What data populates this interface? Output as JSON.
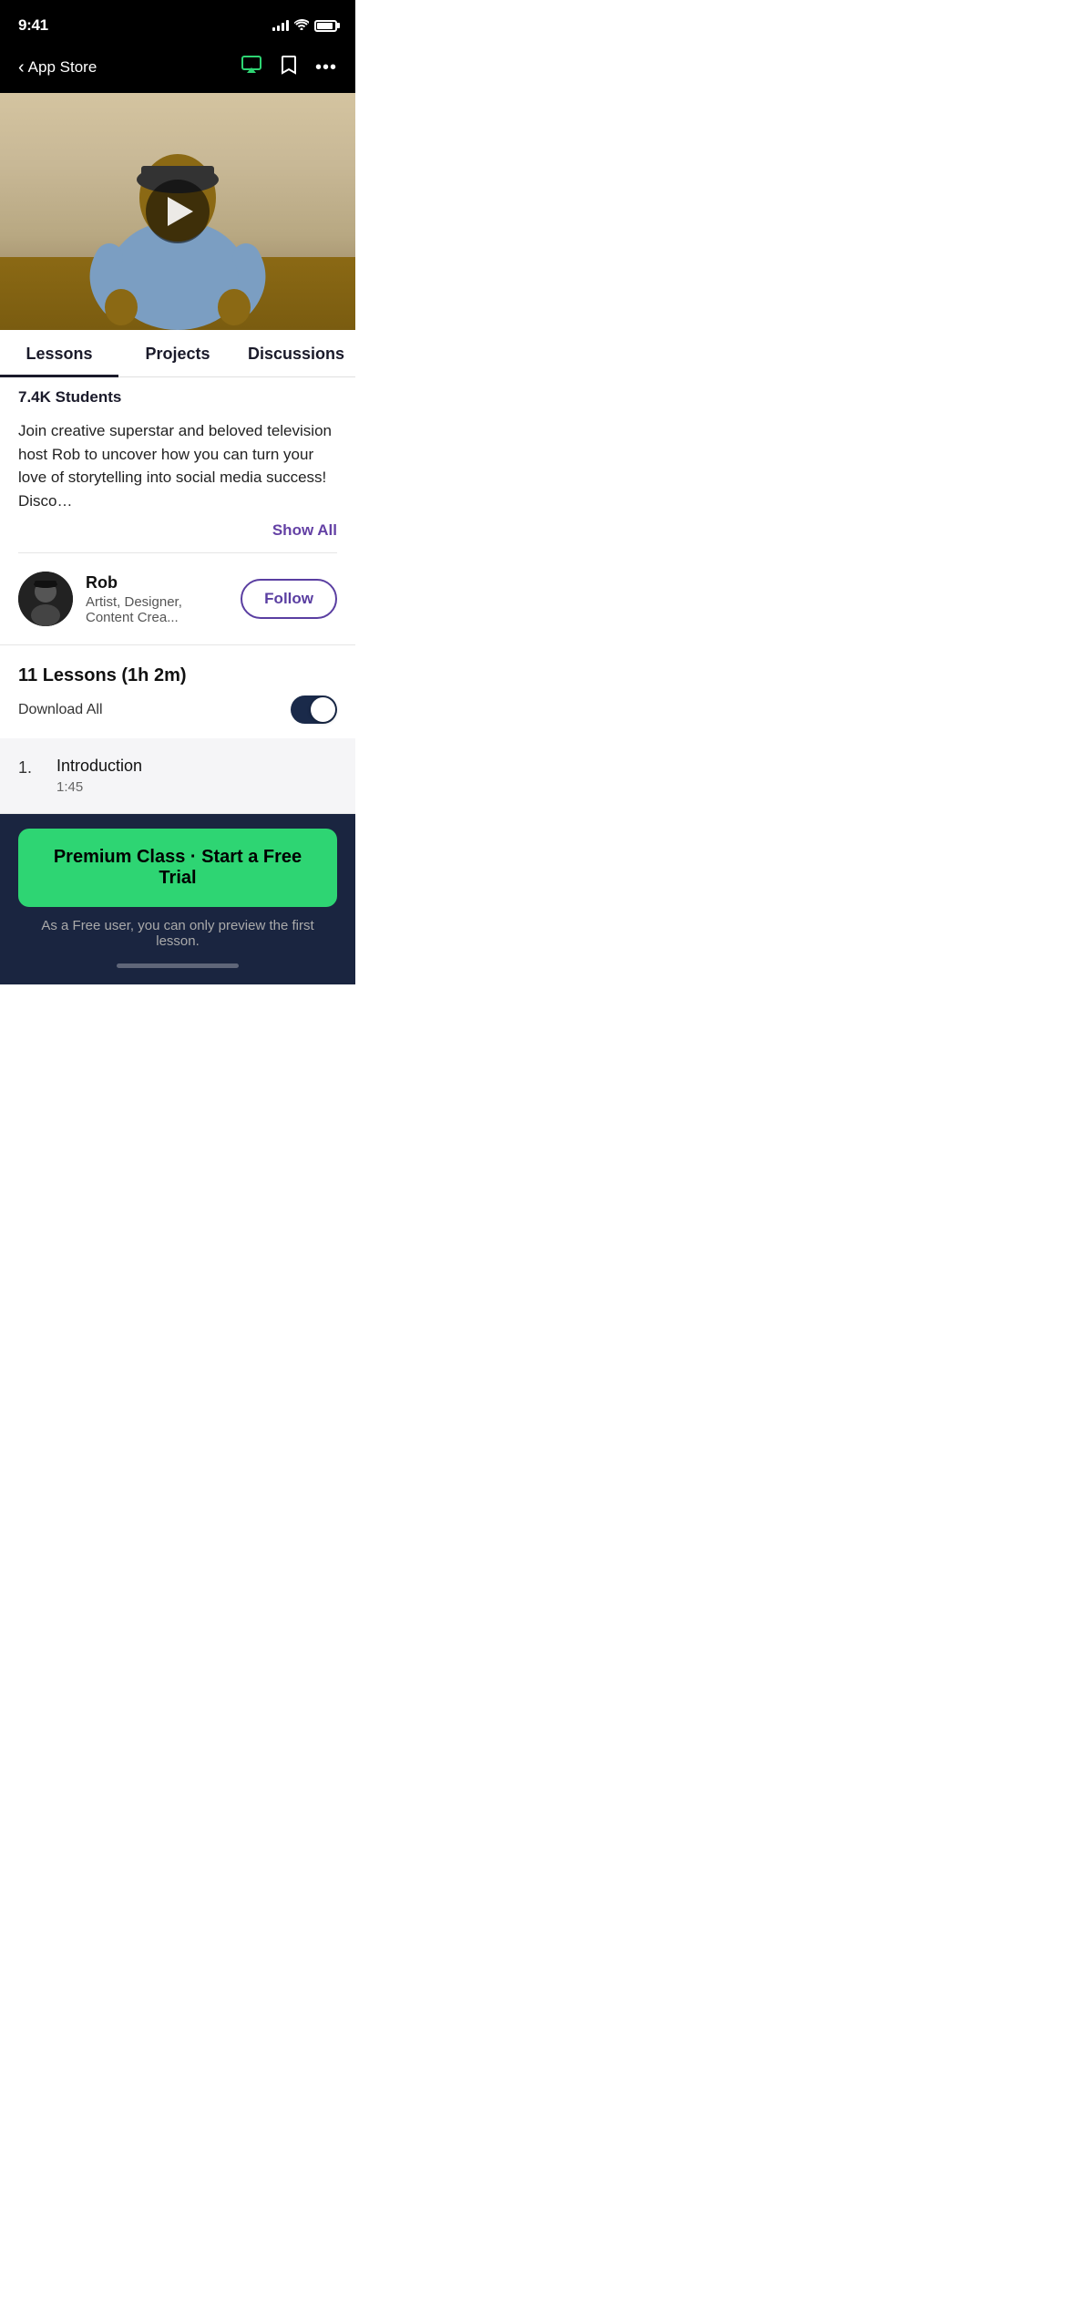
{
  "statusBar": {
    "time": "9:41",
    "backLabel": "App Store"
  },
  "tabs": [
    {
      "label": "Lessons",
      "active": true
    },
    {
      "label": "Projects",
      "active": false
    },
    {
      "label": "Discussions",
      "active": false
    }
  ],
  "content": {
    "studentsLabel": "7.4K Students",
    "description": "Join creative superstar and beloved television host Rob to uncover how you can turn your love of storytelling into social media success!  Disco…",
    "showAllLabel": "Show All",
    "instructor": {
      "name": "Rob",
      "title": "Artist, Designer, Content Crea...",
      "followLabel": "Follow"
    },
    "lessonsHeader": "11 Lessons (1h 2m)",
    "downloadLabel": "Download All",
    "lessons": [
      {
        "number": "1.",
        "title": "Introduction",
        "duration": "1:45"
      }
    ]
  },
  "cta": {
    "buttonLabel": "Premium Class · Start a Free Trial",
    "subtitle": "As a Free user, you can only preview the first lesson."
  }
}
